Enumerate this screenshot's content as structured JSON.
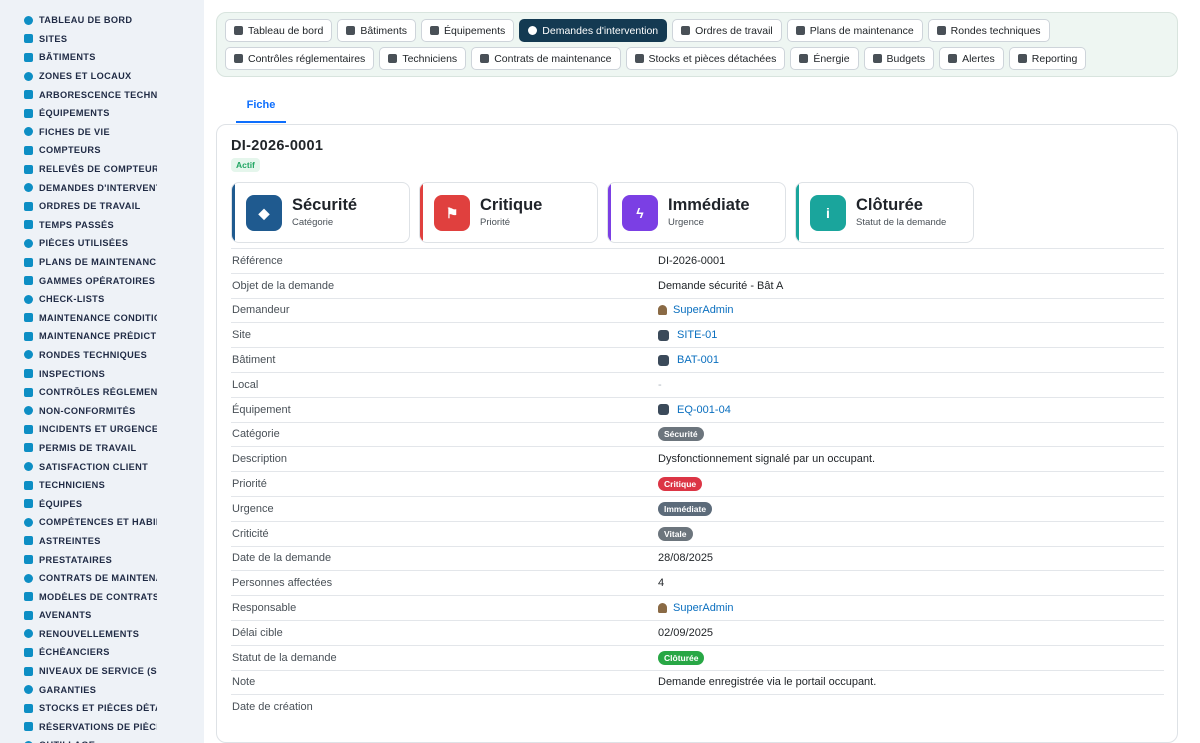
{
  "sidebar": {
    "items": [
      {
        "label": "TABLEAU DE BORD",
        "icon": "dashboard-icon"
      },
      {
        "label": "SITES",
        "icon": "map-pin-icon"
      },
      {
        "label": "BÂTIMENTS",
        "icon": "building-icon"
      },
      {
        "label": "ZONES ET LOCAUX",
        "icon": "door-icon"
      },
      {
        "label": "ARBORESCENCE TECHNIQUE",
        "icon": "sitemap-icon"
      },
      {
        "label": "ÉQUIPEMENTS",
        "icon": "gears-icon"
      },
      {
        "label": "FICHES DE VIE",
        "icon": "history-icon"
      },
      {
        "label": "COMPTEURS",
        "icon": "gauge-icon"
      },
      {
        "label": "RELEVÉS DE COMPTEURS",
        "icon": "clipboard-icon"
      },
      {
        "label": "DEMANDES D'INTERVENTION",
        "icon": "question-icon"
      },
      {
        "label": "ORDRES DE TRAVAIL",
        "icon": "clipboard-check-icon"
      },
      {
        "label": "TEMPS PASSÉS",
        "icon": "clock-icon"
      },
      {
        "label": "PIÈCES UTILISÉES",
        "icon": "cubes-icon"
      },
      {
        "label": "PLANS DE MAINTENANCE",
        "icon": "calendar-icon"
      },
      {
        "label": "GAMMES OPÉRATOIRES",
        "icon": "list-ordered-icon"
      },
      {
        "label": "CHECK-LISTS",
        "icon": "list-check-icon"
      },
      {
        "label": "MAINTENANCE CONDITIONNELLE",
        "icon": "thermometer-icon"
      },
      {
        "label": "MAINTENANCE PRÉDICTIVE",
        "icon": "chart-icon"
      },
      {
        "label": "RONDES TECHNIQUES",
        "icon": "route-icon"
      },
      {
        "label": "INSPECTIONS",
        "icon": "search-icon"
      },
      {
        "label": "CONTRÔLES RÉGLEMENTAIRES",
        "icon": "clipboard-list-icon"
      },
      {
        "label": "NON-CONFORMITÉS",
        "icon": "exclamation-icon"
      },
      {
        "label": "INCIDENTS ET URGENCES",
        "icon": "warning-icon"
      },
      {
        "label": "PERMIS DE TRAVAIL",
        "icon": "file-signature-icon"
      },
      {
        "label": "SATISFACTION CLIENT",
        "icon": "smile-icon"
      },
      {
        "label": "TECHNICIENS",
        "icon": "hard-hat-icon"
      },
      {
        "label": "ÉQUIPES",
        "icon": "users-icon"
      },
      {
        "label": "COMPÉTENCES ET HABILITATIONS",
        "icon": "certificate-icon"
      },
      {
        "label": "ASTREINTES",
        "icon": "phone-icon"
      },
      {
        "label": "PRESTATAIRES",
        "icon": "handshake-icon"
      },
      {
        "label": "CONTRATS DE MAINTENANCE",
        "icon": "file-contract-icon"
      },
      {
        "label": "MODÈLES DE CONTRATS",
        "icon": "file-icon"
      },
      {
        "label": "AVENANTS",
        "icon": "file-edit-icon"
      },
      {
        "label": "RENOUVELLEMENTS",
        "icon": "refresh-icon"
      },
      {
        "label": "ÉCHÉANCIERS",
        "icon": "calendar-days-icon"
      },
      {
        "label": "NIVEAUX DE SERVICE (SLA)",
        "icon": "tachometer-icon"
      },
      {
        "label": "GARANTIES",
        "icon": "shield-icon"
      },
      {
        "label": "STOCKS ET PIÈCES DÉTACHÉES",
        "icon": "boxes-icon"
      },
      {
        "label": "RÉSERVATIONS DE PIÈCES",
        "icon": "bookmark-icon"
      },
      {
        "label": "OUTILLAGE",
        "icon": "tools-icon"
      }
    ]
  },
  "topnav": {
    "row1": [
      {
        "label": "Tableau de bord",
        "icon": "dashboard-icon"
      },
      {
        "label": "Bâtiments",
        "icon": "building-icon"
      },
      {
        "label": "Équipements",
        "icon": "gears-icon"
      },
      {
        "label": "Demandes d'intervention",
        "icon": "question-icon",
        "active": true
      },
      {
        "label": "Ordres de travail",
        "icon": "clipboard-check-icon"
      },
      {
        "label": "Plans de maintenance",
        "icon": "calendar-icon"
      },
      {
        "label": "Rondes techniques",
        "icon": "route-icon"
      }
    ],
    "row2": [
      {
        "label": "Contrôles réglementaires",
        "icon": "clipboard-list-icon"
      },
      {
        "label": "Techniciens",
        "icon": "hard-hat-icon"
      },
      {
        "label": "Contrats de maintenance",
        "icon": "file-contract-icon"
      },
      {
        "label": "Stocks et pièces détachées",
        "icon": "cubes-icon"
      },
      {
        "label": "Énergie",
        "icon": "bolt-icon"
      },
      {
        "label": "Budgets",
        "icon": "money-icon"
      },
      {
        "label": "Alertes",
        "icon": "bell-icon"
      },
      {
        "label": "Reporting",
        "icon": "pie-chart-icon"
      }
    ]
  },
  "tabs": {
    "fiche": "Fiche"
  },
  "record": {
    "reference": "DI-2026-0001",
    "status": "Actif"
  },
  "stats": [
    {
      "value": "Sécurité",
      "label": "Catégorie",
      "color": "#1f5a8f",
      "icon": "tag-icon",
      "glyph": "◆"
    },
    {
      "value": "Critique",
      "label": "Priorité",
      "color": "#e0403e",
      "icon": "flag-icon",
      "glyph": "⚑"
    },
    {
      "value": "Immédiate",
      "label": "Urgence",
      "color": "#7b3fe4",
      "icon": "bolt-icon",
      "glyph": "ϟ"
    },
    {
      "value": "Clôturée",
      "label": "Statut de la demande",
      "color": "#1aa59c",
      "icon": "info-icon",
      "glyph": "i"
    }
  ],
  "details": {
    "reference": {
      "label": "Référence",
      "value": "DI-2026-0001"
    },
    "objet": {
      "label": "Objet de la demande",
      "value": "Demande sécurité - Bât A"
    },
    "demandeur": {
      "label": "Demandeur",
      "value": "SuperAdmin"
    },
    "site": {
      "label": "Site",
      "value": "SITE-01"
    },
    "batiment": {
      "label": "Bâtiment",
      "value": "BAT-001"
    },
    "local": {
      "label": "Local",
      "value": "-"
    },
    "equipement": {
      "label": "Équipement",
      "value": "EQ-001-04"
    },
    "categorie": {
      "label": "Catégorie",
      "value": "Sécurité",
      "color": "#6c757d"
    },
    "description": {
      "label": "Description",
      "value": "Dysfonctionnement signalé par un occupant."
    },
    "priorite": {
      "label": "Priorité",
      "value": "Critique",
      "color": "#dc3545"
    },
    "urgence": {
      "label": "Urgence",
      "value": "Immédiate",
      "color": "#5c6b7a"
    },
    "criticite": {
      "label": "Criticité",
      "value": "Vitale",
      "color": "#6c757d"
    },
    "date_demande": {
      "label": "Date de la demande",
      "value": "28/08/2025"
    },
    "personnes": {
      "label": "Personnes affectées",
      "value": "4"
    },
    "responsable": {
      "label": "Responsable",
      "value": "SuperAdmin"
    },
    "delai": {
      "label": "Délai cible",
      "value": "02/09/2025"
    },
    "statut": {
      "label": "Statut de la demande",
      "value": "Clôturée",
      "color": "#28a745"
    },
    "note": {
      "label": "Note",
      "value": "Demande enregistrée via le portail occupant."
    },
    "date_creation": {
      "label": "Date de création",
      "value": ""
    }
  }
}
